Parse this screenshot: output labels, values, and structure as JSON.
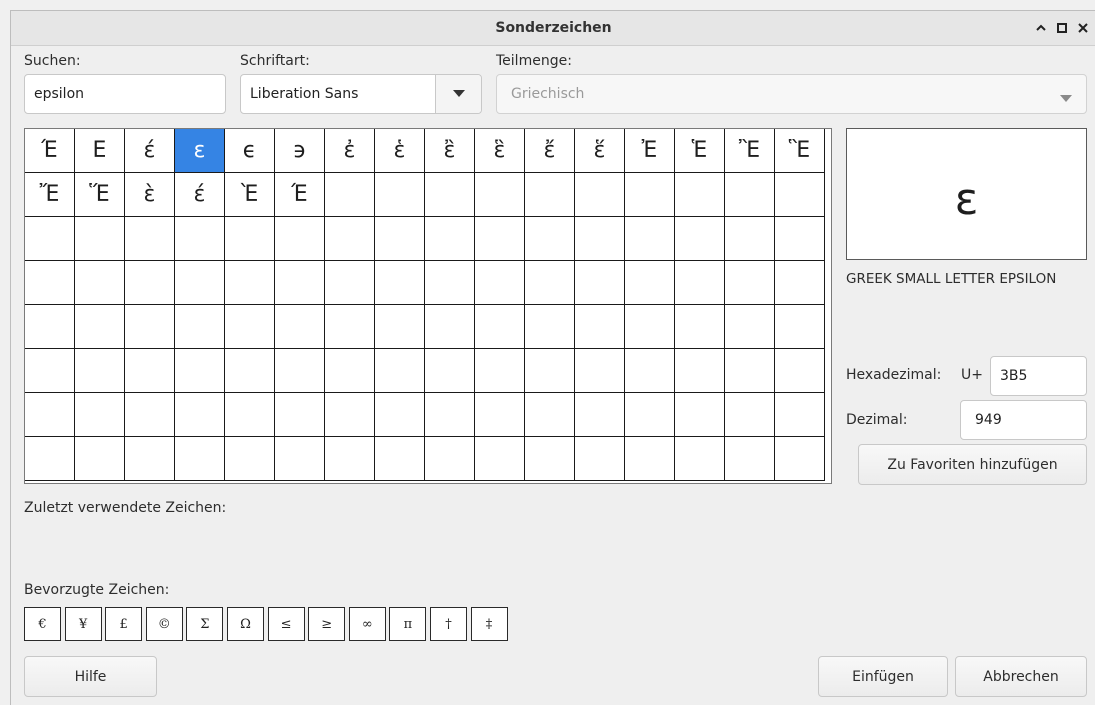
{
  "window": {
    "title": "Sonderzeichen"
  },
  "search": {
    "label": "Suchen:",
    "value": "epsilon"
  },
  "font": {
    "label": "Schriftart:",
    "value": "Liberation Sans"
  },
  "subset": {
    "label": "Teilmenge:",
    "value": "Griechisch"
  },
  "grid": {
    "characters": [
      "Έ",
      "Ε",
      "έ",
      "ε",
      "ϵ",
      "϶",
      "ἐ",
      "ἑ",
      "ἒ",
      "ἓ",
      "ἔ",
      "ἕ",
      "Ἐ",
      "Ἑ",
      "Ἒ",
      "Ἓ",
      "Ἔ",
      "Ἕ",
      "ὲ",
      "έ",
      "Ὲ",
      "Έ"
    ],
    "selected_index": 3
  },
  "detail": {
    "preview_char": "ε",
    "name": "GREEK SMALL LETTER EPSILON",
    "hex_label": "Hexadezimal:",
    "hex_prefix": "U+",
    "hex_value": "3B5",
    "dec_label": "Dezimal:",
    "dec_value": "949",
    "add_favorite_label": "Zu Favoriten hinzufügen"
  },
  "recent": {
    "label": "Zuletzt verwendete Zeichen:"
  },
  "favorites": {
    "label": "Bevorzugte Zeichen:",
    "characters": [
      "€",
      "¥",
      "£",
      "©",
      "Σ",
      "Ω",
      "≤",
      "≥",
      "∞",
      "π",
      "†",
      "‡"
    ]
  },
  "buttons": {
    "help": "Hilfe",
    "insert": "Einfügen",
    "cancel": "Abbrechen"
  },
  "icons": {
    "minimize": "chevron-up-icon",
    "maximize": "maximize-icon",
    "close": "close-icon",
    "dropdown": "dropdown-arrow-icon"
  },
  "colors": {
    "selection": "#3584e4"
  }
}
